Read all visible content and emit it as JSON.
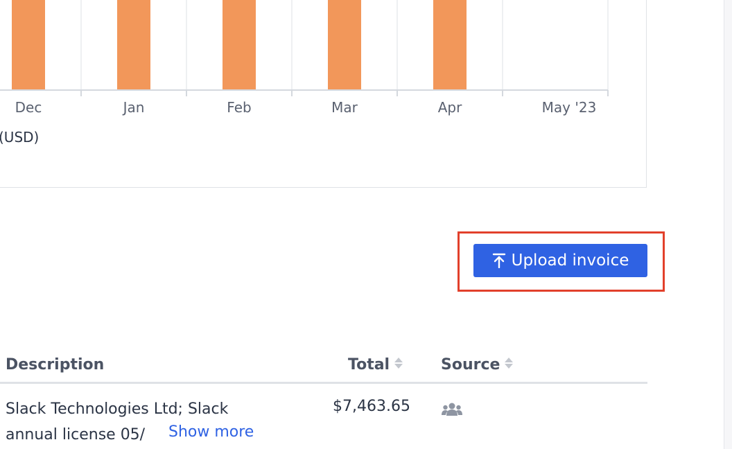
{
  "chart_data": {
    "type": "bar",
    "categories": [
      "Dec",
      "Jan",
      "Feb",
      "Mar",
      "Apr",
      "May '23"
    ],
    "currency_label": "(USD)",
    "bar_color": "#f2975a",
    "visible_bars": [
      true,
      true,
      true,
      true,
      true,
      false
    ]
  },
  "actions": {
    "upload_label": "Upload invoice"
  },
  "table": {
    "columns": {
      "description": "Description",
      "total": "Total",
      "source": "Source"
    },
    "rows": [
      {
        "description_line1": "Slack Technologies Ltd; Slack",
        "description_line2": "annual license 05/",
        "show_more": "Show more",
        "total": "$7,463.65",
        "source_icon": "users-icon"
      }
    ]
  },
  "colors": {
    "primary": "#2f62e3",
    "highlight": "#e2402b",
    "bar": "#f2975a"
  }
}
